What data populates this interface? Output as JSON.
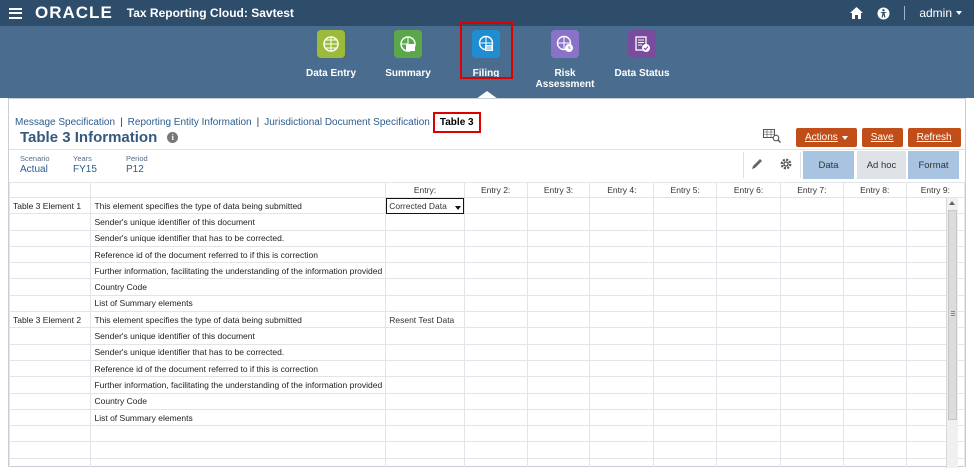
{
  "topbar": {
    "brand": "ORACLE",
    "app_title": "Tax Reporting Cloud: Savtest",
    "user": "admin"
  },
  "nav": {
    "items": [
      {
        "label": "Data Entry",
        "icon": "table-grid-icon",
        "color": "#9dbb3a"
      },
      {
        "label": "Summary",
        "icon": "summary-table-icon",
        "color": "#5aa84a"
      },
      {
        "label": "Filing",
        "icon": "globe-document-icon",
        "color": "#1f8dd2"
      },
      {
        "label": "Risk Assessment",
        "icon": "globe-clock-icon",
        "color": "#8a72c8"
      },
      {
        "label": "Data Status",
        "icon": "document-check-icon",
        "color": "#7a4c9e"
      }
    ]
  },
  "breadcrumb": {
    "items": [
      "Message Specification",
      "Reporting Entity Information",
      "Jurisdictional Document Specification"
    ],
    "active": "Table 3"
  },
  "page": {
    "title": "Table 3 Information",
    "info_icon": "i"
  },
  "toolbar": {
    "actions_label": "Actions",
    "save_label": "Save",
    "refresh_label": "Refresh",
    "tab_data": "Data",
    "tab_adhoc": "Ad hoc",
    "tab_format": "Format"
  },
  "pov": [
    {
      "label": "Scenario",
      "value": "Actual"
    },
    {
      "label": "Years",
      "value": "FY15"
    },
    {
      "label": "Period",
      "value": "P12"
    }
  ],
  "grid": {
    "columns": [
      "Entry:",
      "Entry 2:",
      "Entry 3:",
      "Entry 4:",
      "Entry 5:",
      "Entry 6:",
      "Entry 7:",
      "Entry 8:",
      "Entry 9:"
    ],
    "groups": [
      {
        "name": "Table 3 Element 1",
        "rows": [
          {
            "label": "This element specifies the type of data being submitted",
            "entry": "Corrected Data",
            "dropdown": true
          },
          {
            "label": "Sender's unique identifier of this document",
            "entry": ""
          },
          {
            "label": "Sender's unique identifier that has to be corrected.",
            "entry": ""
          },
          {
            "label": "Reference id of the document referred to if this is correction",
            "entry": ""
          },
          {
            "label": "Further information, facilitating the understanding of the information provided",
            "entry": ""
          },
          {
            "label": "Country Code",
            "entry": ""
          },
          {
            "label": "List of Summary elements",
            "entry": ""
          }
        ]
      },
      {
        "name": "Table 3 Element 2",
        "rows": [
          {
            "label": "This element specifies the type of data being submitted",
            "entry": "Resent Test Data"
          },
          {
            "label": "Sender's unique identifier of this document",
            "entry": ""
          },
          {
            "label": "Sender's unique identifier that has to be corrected.",
            "entry": ""
          },
          {
            "label": "Reference id of the document referred to if this is correction",
            "entry": ""
          },
          {
            "label": "Further information, facilitating the understanding of the information provided",
            "entry": ""
          },
          {
            "label": "Country Code",
            "entry": ""
          },
          {
            "label": "List of Summary elements",
            "entry": ""
          }
        ]
      }
    ]
  },
  "colors": {
    "topbar": "#2e4d6b",
    "navband": "#4a6d8f",
    "accent_button": "#c14e18",
    "title": "#34597f",
    "highlight": "#dd0000"
  }
}
